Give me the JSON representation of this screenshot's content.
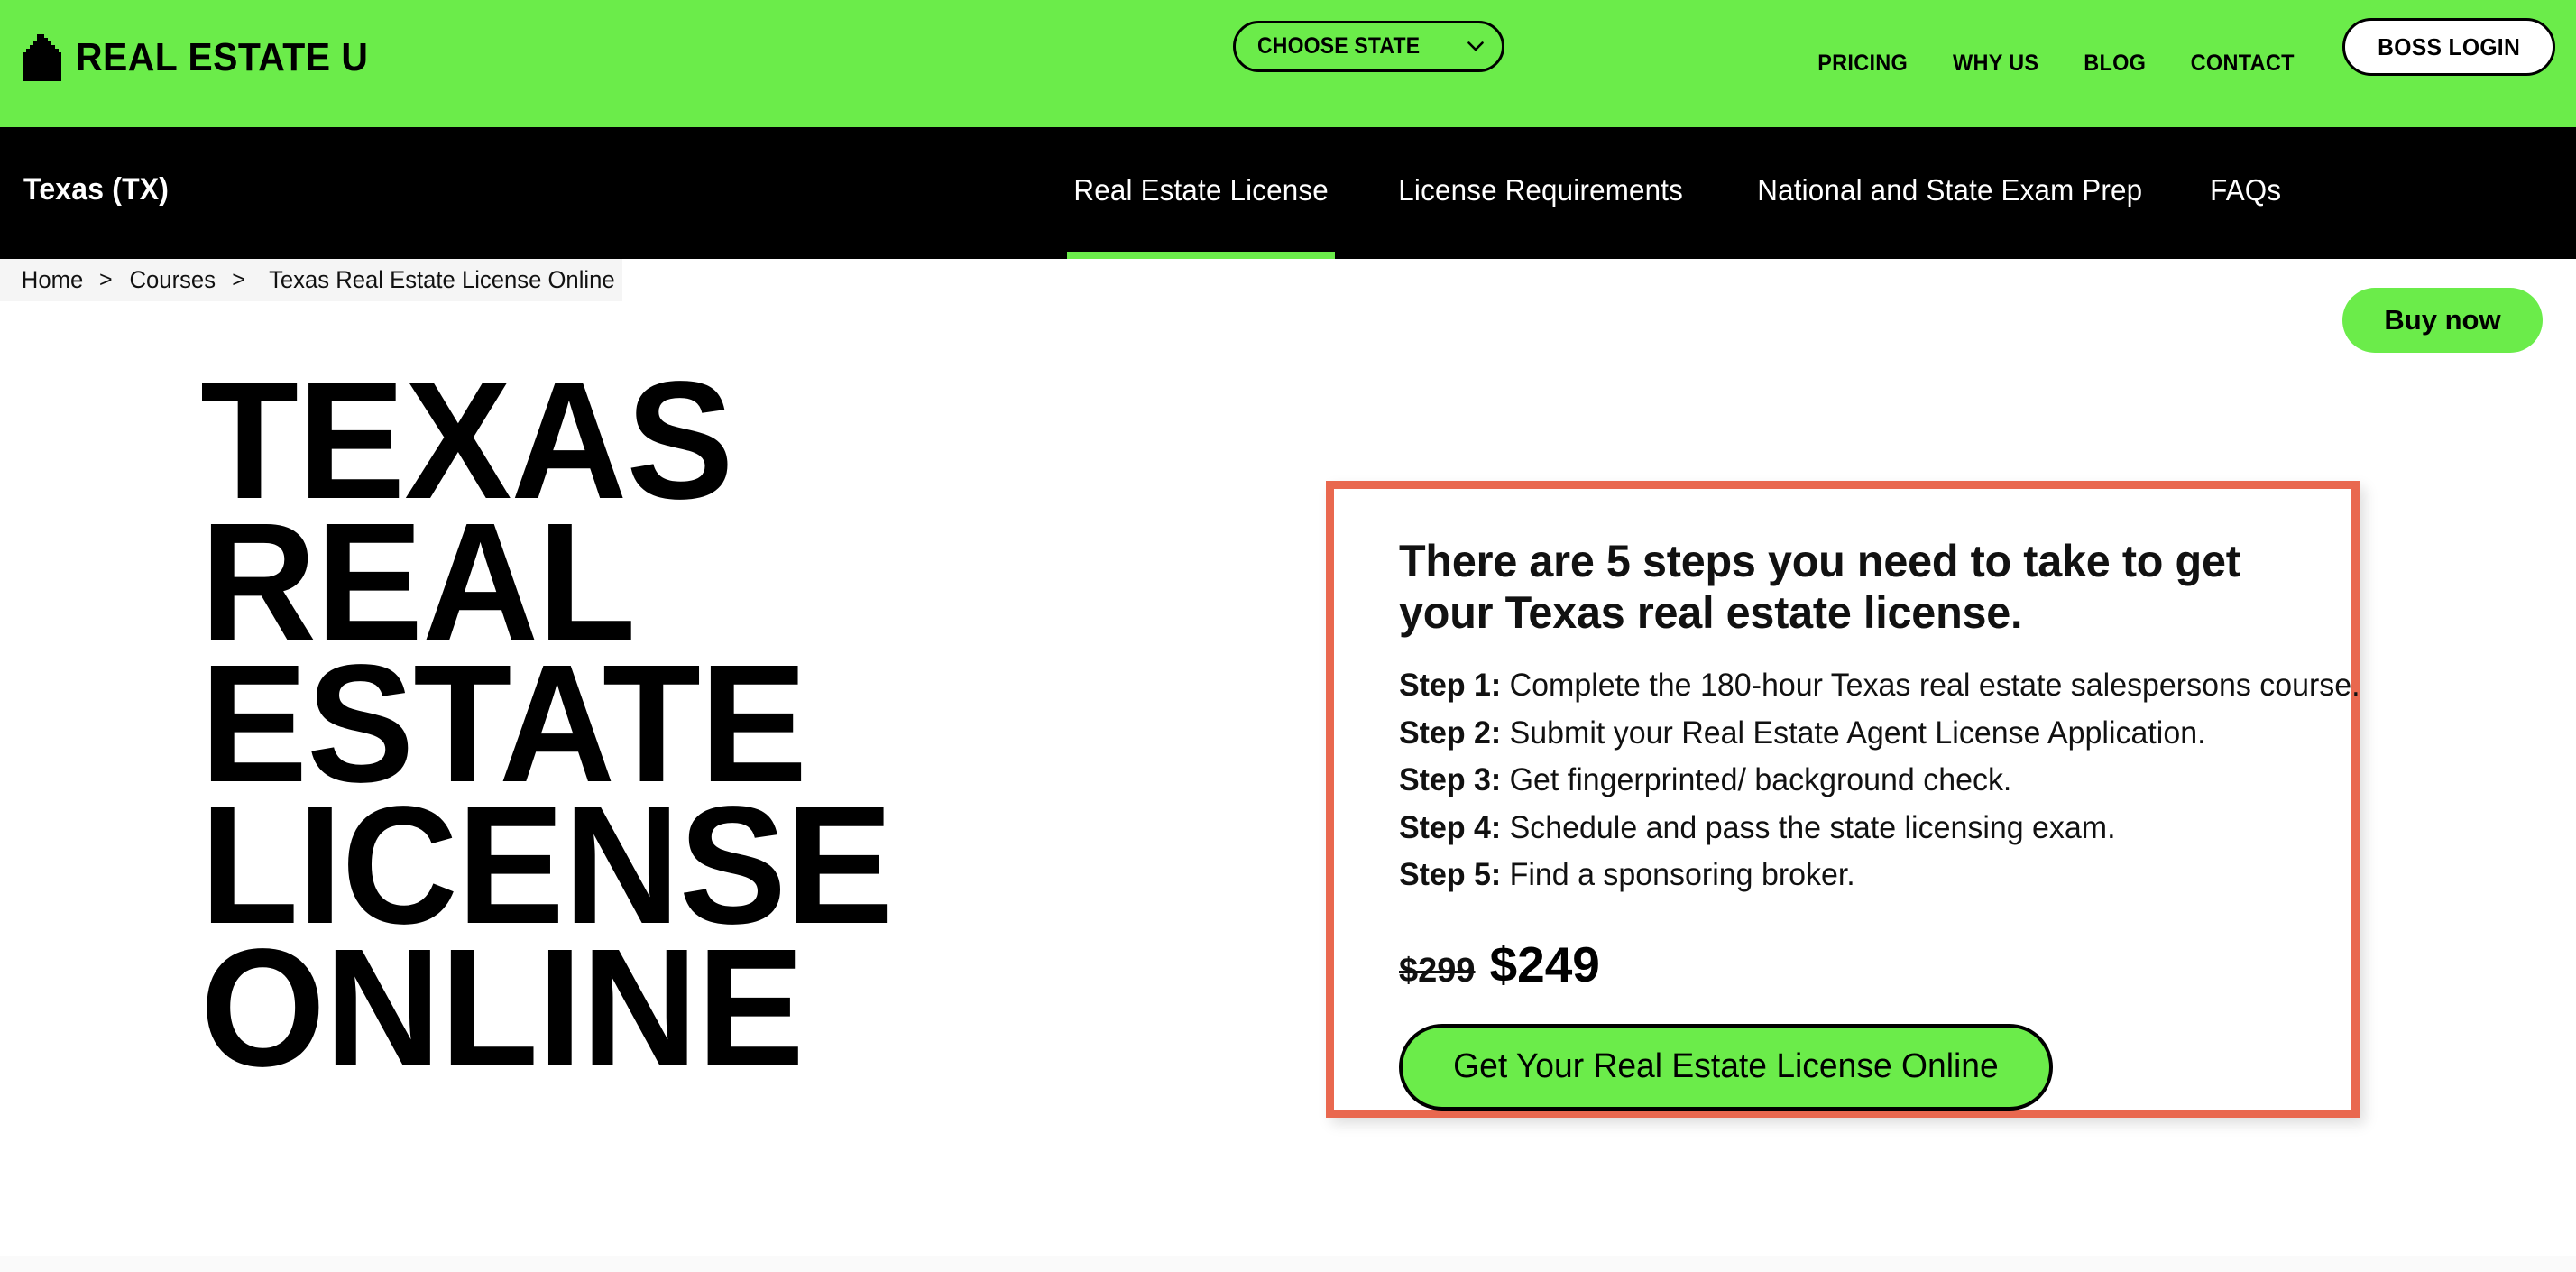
{
  "header": {
    "logo": {
      "icon": "house-icon",
      "text": "REAL ESTATE U"
    },
    "state_select": {
      "label": "CHOOSE STATE",
      "icon": "chevron-down-icon"
    },
    "nav": [
      {
        "label": "PRICING"
      },
      {
        "label": "WHY US"
      },
      {
        "label": "BLOG"
      },
      {
        "label": "CONTACT"
      }
    ],
    "boss_login_label": "BOSS LOGIN",
    "background_color": "#6bec4a"
  },
  "subnav": {
    "state_title": "Texas (TX)",
    "tabs": [
      {
        "label": "Real Estate License",
        "active": true
      },
      {
        "label": "License Requirements",
        "active": false
      },
      {
        "label": "National and State Exam Prep",
        "active": false
      },
      {
        "label": "FAQs",
        "active": false
      }
    ],
    "buy_now_label": "Buy now",
    "background_color": "#000000",
    "active_indicator_color": "#6bec4a"
  },
  "breadcrumb": {
    "items": [
      {
        "label": "Home"
      },
      {
        "label": "Courses"
      },
      {
        "label": "Texas Real Estate License Online"
      }
    ],
    "separator": ">"
  },
  "hero": {
    "title_lines": [
      "TEXAS",
      "REAL",
      "ESTATE",
      "LICENSE",
      "ONLINE"
    ]
  },
  "steps_card": {
    "border_color": "#e9684f",
    "heading": "There are 5 steps you need to take to get your Texas real estate license.",
    "steps": [
      {
        "label": "Step 1:",
        "text": " Complete the 180-hour Texas real estate salespersons course."
      },
      {
        "label": "Step 2:",
        "text": " Submit your Real Estate Agent License Application."
      },
      {
        "label": "Step 3:",
        "text": " Get fingerprinted/ background check."
      },
      {
        "label": "Step 4:",
        "text": " Schedule and pass the state licensing exam."
      },
      {
        "label": "Step 5:",
        "text": " Find a sponsoring broker."
      }
    ],
    "price_original": "$299",
    "price_current": "$249",
    "cta_label": "Get Your Real Estate License Online",
    "cta_color": "#6bec4a"
  }
}
